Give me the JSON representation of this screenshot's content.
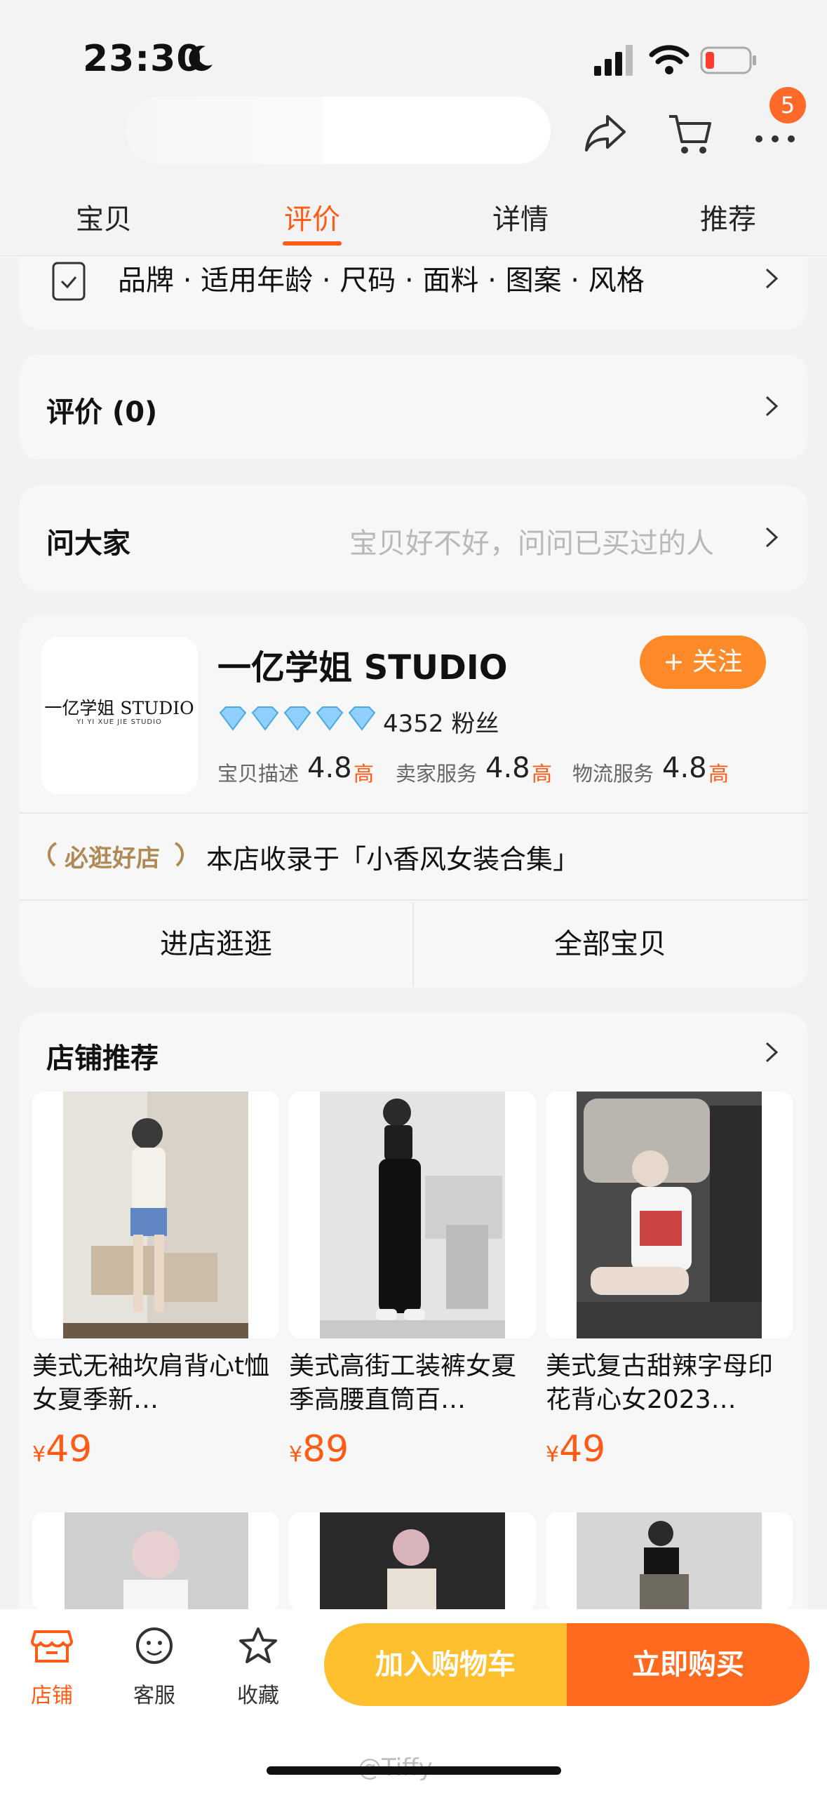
{
  "status_bar": {
    "time": "23:30"
  },
  "header": {
    "badge_count": "5"
  },
  "tabs": [
    {
      "label": "宝贝"
    },
    {
      "label": "评价"
    },
    {
      "label": "详情"
    },
    {
      "label": "推荐"
    }
  ],
  "attributes_row": {
    "text": "品牌 · 适用年龄 · 尺码 · 面料 · 图案 · 风格"
  },
  "reviews": {
    "label": "评价 (0)"
  },
  "ask": {
    "label": "问大家",
    "hint": "宝贝好不好，问问已买过的人"
  },
  "shop": {
    "logo_text": "一亿学姐 STUDIO",
    "logo_subtext": "YI YI XUE JIE STUDIO",
    "name": "一亿学姐 STUDIO",
    "follow_label": "+ 关注",
    "fans": "4352 粉丝",
    "scores": [
      {
        "label": "宝贝描述",
        "value": "4.8",
        "tag": "高"
      },
      {
        "label": "卖家服务",
        "value": "4.8",
        "tag": "高"
      },
      {
        "label": "物流服务",
        "value": "4.8",
        "tag": "高"
      }
    ],
    "featured_label": "必逛好店",
    "featured_text": "本店收录于「小香风女装合集」",
    "enter_label": "进店逛逛",
    "all_items_label": "全部宝贝"
  },
  "recommend": {
    "title": "店铺推荐",
    "products": [
      {
        "title": "美式无袖坎肩背心t恤女夏季新…",
        "currency": "¥",
        "price": "49"
      },
      {
        "title": "美式高街工装裤女夏季高腰直筒百…",
        "currency": "¥",
        "price": "89"
      },
      {
        "title": "美式复古甜辣字母印花背心女2023…",
        "currency": "¥",
        "price": "49"
      }
    ]
  },
  "bottom_bar": {
    "shop_label": "店铺",
    "service_label": "客服",
    "favorite_label": "收藏",
    "add_cart_label": "加入购物车",
    "buy_now_label": "立即购买"
  },
  "watermark": "@Tiffy",
  "colors": {
    "accent": "#ff5b16",
    "follow": "#ff8a2a",
    "cart": "#ffc030",
    "buy": "#ff6a1f"
  }
}
